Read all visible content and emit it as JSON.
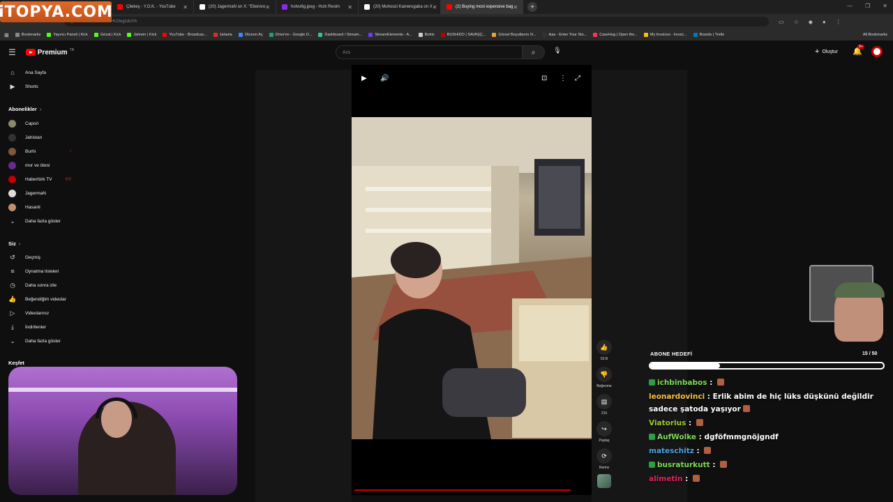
{
  "overlay_logo": "iTOPYA.COM",
  "browser": {
    "tabs": [
      {
        "label": "Çilekeş - Y.O.K. - YouTube",
        "color": "#ff0000"
      },
      {
        "label": "(20) JagermaN on X: \"Ebonivo",
        "color": "#ffffff"
      },
      {
        "label": "holvu6g.jpeg - Hızlı Resim",
        "color": "#8a2be2"
      },
      {
        "label": "(20) Muhoozi Kainerugaba on X",
        "color": "#ffffff"
      },
      {
        "label": "(2) Buying most expensive bag",
        "color": "#ff0000",
        "active": true
      }
    ],
    "new_tab": "+",
    "window_controls": [
      "—",
      "❐",
      "✕"
    ],
    "address": "youtube.com/shorts/zHU2wg1doYA",
    "bookmarks": [
      {
        "label": "Bookmarks",
        "color": "#888888"
      },
      {
        "label": "Yayıncı Paneli | Kick",
        "color": "#53fc18"
      },
      {
        "label": "Gözat | Kick",
        "color": "#53fc18"
      },
      {
        "label": "Jahrein | Kick",
        "color": "#53fc18"
      },
      {
        "label": "YouTube - Broadcas...",
        "color": "#ff0000"
      },
      {
        "label": "Jaharia",
        "color": "#d93025"
      },
      {
        "label": "Oturum Aç",
        "color": "#4285f4"
      },
      {
        "label": "Drive'ım - Google D...",
        "color": "#1fa463"
      },
      {
        "label": "Dashboard / Stream...",
        "color": "#31c3a2"
      },
      {
        "label": "StreamElements - A...",
        "color": "#6a3cff"
      },
      {
        "label": "Botrix",
        "color": "#cccccc"
      },
      {
        "label": "BUSHIDO | SAVAŞÇ...",
        "color": "#c00000"
      },
      {
        "label": "Görsel Boyutlarını N...",
        "color": "#e8a23a"
      },
      {
        "label": "ikas - Enter Your Sto...",
        "color": "#333333"
      },
      {
        "label": "CaseHug | Open the...",
        "color": "#ff3355"
      },
      {
        "label": "My Invoices - Invoic...",
        "color": "#f4c20d"
      },
      {
        "label": "Boards | Trello",
        "color": "#0079bf"
      }
    ],
    "all_bookmarks": "All Bookmarks"
  },
  "youtube": {
    "brand": "Premium",
    "brand_suffix": "TR",
    "search_placeholder": "Ara",
    "create_label": "Oluştur",
    "notification_count": "9+",
    "sidebar": {
      "main": [
        {
          "label": "Ana Sayfa",
          "icon": "home-icon"
        },
        {
          "label": "Shorts",
          "icon": "shorts-icon"
        }
      ],
      "subscriptions_title": "Abonelikler",
      "subscriptions": [
        {
          "label": "Capori",
          "color": "#8a8a6a"
        },
        {
          "label": "Jahistan",
          "color": "#333333"
        },
        {
          "label": "Burhi",
          "color": "#7a5a3a",
          "live": "•"
        },
        {
          "label": "mor ve ötesi",
          "color": "#6a2a8a"
        },
        {
          "label": "Habertürk TV",
          "color": "#c00000",
          "live": "((•))"
        },
        {
          "label": "JagermaN",
          "color": "#dddddd"
        },
        {
          "label": "Hasanli",
          "color": "#c09070"
        }
      ],
      "subs_more": "Daha fazla göster",
      "you_title": "Siz",
      "you_items": [
        {
          "label": "Geçmiş",
          "icon": "history-icon"
        },
        {
          "label": "Oynatma listeleri",
          "icon": "playlist-icon"
        },
        {
          "label": "Daha sonra izle",
          "icon": "clock-icon"
        },
        {
          "label": "Beğendiğim videolar",
          "icon": "like-icon"
        },
        {
          "label": "Videolarınız",
          "icon": "video-icon"
        },
        {
          "label": "İndirilenler",
          "icon": "download-icon"
        }
      ],
      "you_more": "Daha fazla göster",
      "explore_title": "Keşfet"
    },
    "actions": {
      "like_count": "53 B",
      "dislike_label": "Beğenme",
      "comment_count": "210",
      "share_label": "Paylaş",
      "remix_label": "Remix"
    },
    "progress_fraction": 0.95
  },
  "stream_overlay": {
    "goal_title": "ABONE HEDEFİ",
    "goal_count": "15 / 50",
    "goal_fraction": 0.3,
    "chat": [
      {
        "user": "ichbinbabos",
        "color": "#7ed957",
        "text": "",
        "badge": "#2e9e44",
        "emote": true
      },
      {
        "user": "leonardovinci",
        "color": "#f5c242",
        "text": "Erlik abim de hiç lüks düşkünü değildir sadece şatoda yaşıyor",
        "badge": "",
        "emote": true
      },
      {
        "user": "Viatorius",
        "color": "#9acd32",
        "text": "",
        "badge": "",
        "emote": true
      },
      {
        "user": "AufWolke",
        "color": "#7ed957",
        "text": "dgföfmmgnöjgndf",
        "badge": "#2e9e44",
        "emote": false
      },
      {
        "user": "mateschitz",
        "color": "#4aa3df",
        "text": "",
        "badge": "",
        "emote": true
      },
      {
        "user": "busraturkutt",
        "color": "#7ed957",
        "text": "",
        "badge": "#2e9e44",
        "emote": true
      },
      {
        "user": "alimetin",
        "color": "#e0245e",
        "text": "",
        "badge": "",
        "emote": true
      }
    ]
  }
}
